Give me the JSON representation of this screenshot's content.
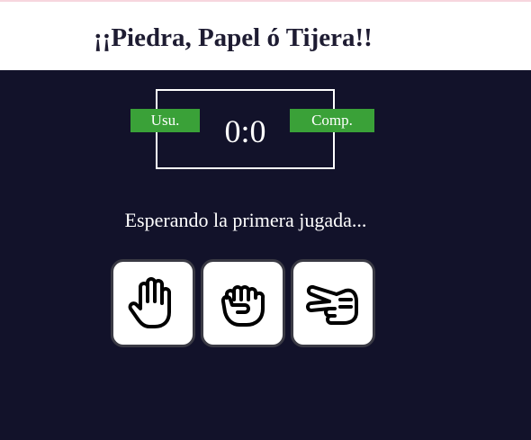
{
  "header": {
    "title": "¡¡Piedra, Papel ó Tijera!!"
  },
  "scoreboard": {
    "user_label": "Usu.",
    "computer_label": "Comp.",
    "score": "0:0"
  },
  "status": {
    "message": "Esperando la primera jugada..."
  },
  "choices": [
    {
      "name": "papel",
      "icon": "open-hand-icon"
    },
    {
      "name": "piedra",
      "icon": "fist-icon"
    },
    {
      "name": "tijera",
      "icon": "scissors-hand-icon"
    }
  ],
  "colors": {
    "background": "#12122a",
    "header_bg": "#ffffff",
    "badge": "#3aa138",
    "title": "#1e1c32"
  }
}
